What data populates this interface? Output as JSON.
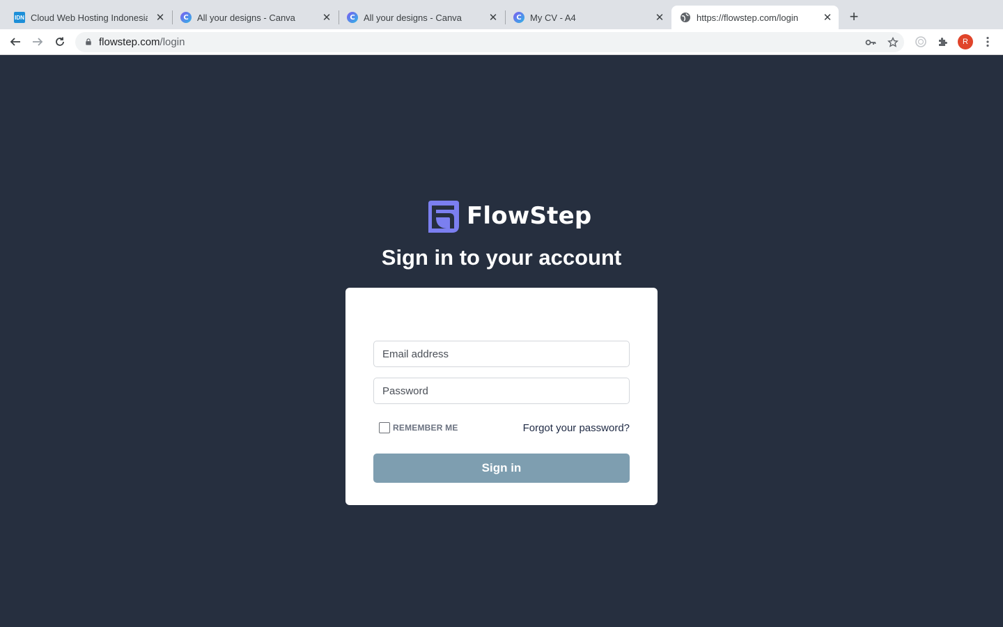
{
  "browser": {
    "tabs": [
      {
        "title": "Cloud Web Hosting Indonesia ",
        "favicon": "idn-favicon",
        "favicon_text": "IDN",
        "active": false
      },
      {
        "title": "All your designs - Canva",
        "favicon": "canva-favicon",
        "favicon_text": "C",
        "active": false
      },
      {
        "title": "All your designs - Canva",
        "favicon": "canva-favicon",
        "favicon_text": "C",
        "active": false
      },
      {
        "title": "My CV - A4",
        "favicon": "canva-favicon",
        "favicon_text": "C",
        "active": false
      },
      {
        "title": "https://flowstep.com/login",
        "favicon": "globe-icon",
        "active": true
      }
    ],
    "close_glyph": "✕",
    "new_tab_glyph": "+",
    "address": {
      "host": "flowstep.com",
      "path": "/login"
    },
    "profile_initial": "R"
  },
  "page": {
    "brand": "FlowStep",
    "title": "Sign in to your account",
    "email_placeholder": "Email address",
    "password_placeholder": "Password",
    "remember_label": "REMEMBER ME",
    "remember_checked": false,
    "forgot_link": "Forgot your password?",
    "signin_label": "Sign in"
  },
  "colors": {
    "page_background": "#262f3f",
    "brand_mark": "#7b7ff0",
    "signin_button": "#7e9eb0",
    "profile_avatar": "#e0442a"
  }
}
